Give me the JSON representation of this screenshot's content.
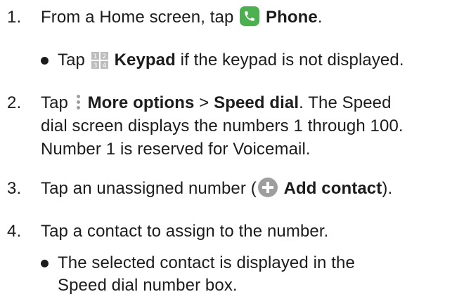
{
  "colors": {
    "text": "#1c1c1c",
    "phone_icon_bg": "#4caf50",
    "grey_icon": "#9e9e9e"
  },
  "steps": [
    {
      "number": "1.",
      "before": "From a Home screen, tap",
      "icon": "phone-icon",
      "bold": "Phone",
      "after": ".",
      "bullet": {
        "before": "Tap",
        "icon": "keypad-icon",
        "bold": "Keypad",
        "after": "if the keypad is not displayed."
      }
    },
    {
      "number": "2.",
      "before": "Tap",
      "icon": "more-options-icon",
      "bold1": "More options",
      "sep": ">",
      "bold2": "Speed dial",
      "after_line1": ". The Speed",
      "line2": "dial screen displays the numbers 1 through 100.",
      "line3": "Number 1 is reserved for Voicemail."
    },
    {
      "number": "3.",
      "before": "Tap an unassigned number (",
      "icon": "add-icon",
      "bold": "Add contact",
      "after": ")."
    },
    {
      "number": "4.",
      "text": "Tap a contact to assign to the number.",
      "bullet": {
        "line1": "The selected contact is displayed in the",
        "line2": "Speed dial number box."
      }
    }
  ]
}
